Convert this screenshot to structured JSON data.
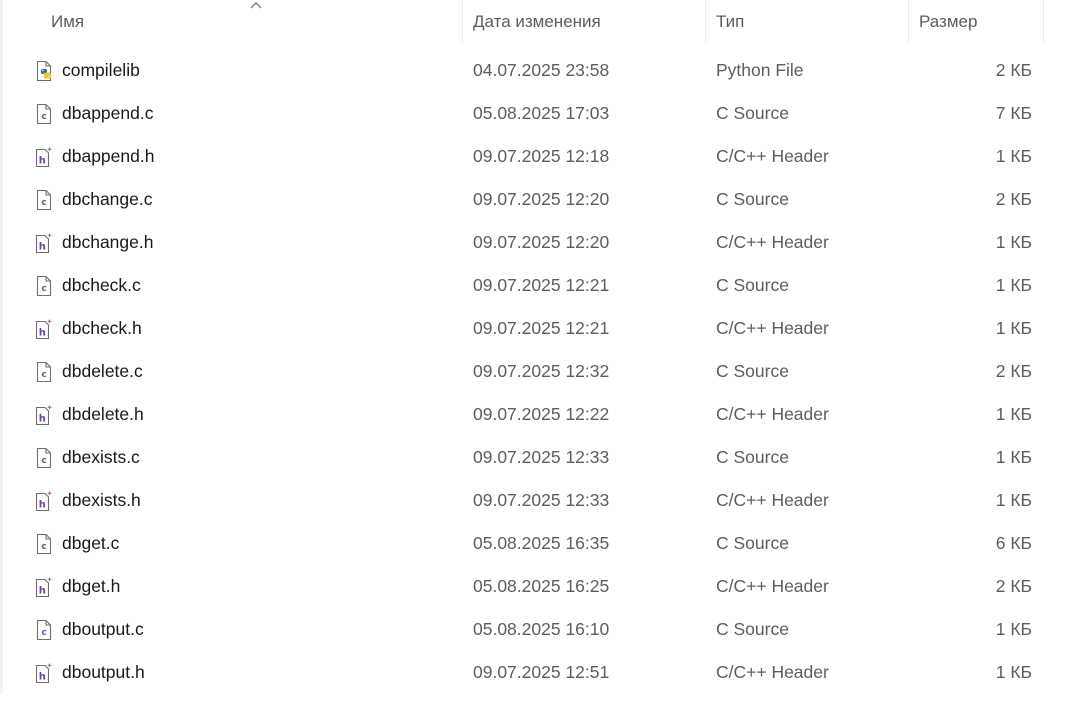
{
  "columns": {
    "name": "Имя",
    "date": "Дата изменения",
    "type": "Тип",
    "size": "Размер"
  },
  "sort": {
    "column": "name",
    "direction": "ascending"
  },
  "colors": {
    "c_source_icon": "#7a4f9a",
    "header_icon": "#6b3fa0",
    "header_icon_accent": "#c74fd0",
    "python_blue": "#3a6ea5",
    "python_yellow": "#f2c42c"
  },
  "files": [
    {
      "name": "compilelib",
      "date": "04.07.2025 23:58",
      "type": "Python File",
      "size": "2 КБ",
      "icon": "python-file-icon"
    },
    {
      "name": "dbappend.c",
      "date": "05.08.2025 17:03",
      "type": "C Source",
      "size": "7 КБ",
      "icon": "c-source-file-icon"
    },
    {
      "name": "dbappend.h",
      "date": "09.07.2025 12:18",
      "type": "C/C++ Header",
      "size": "1 КБ",
      "icon": "c-header-file-icon"
    },
    {
      "name": "dbchange.c",
      "date": "09.07.2025 12:20",
      "type": "C Source",
      "size": "2 КБ",
      "icon": "c-source-file-icon"
    },
    {
      "name": "dbchange.h",
      "date": "09.07.2025 12:20",
      "type": "C/C++ Header",
      "size": "1 КБ",
      "icon": "c-header-file-icon"
    },
    {
      "name": "dbcheck.c",
      "date": "09.07.2025 12:21",
      "type": "C Source",
      "size": "1 КБ",
      "icon": "c-source-file-icon"
    },
    {
      "name": "dbcheck.h",
      "date": "09.07.2025 12:21",
      "type": "C/C++ Header",
      "size": "1 КБ",
      "icon": "c-header-file-icon"
    },
    {
      "name": "dbdelete.c",
      "date": "09.07.2025 12:32",
      "type": "C Source",
      "size": "2 КБ",
      "icon": "c-source-file-icon"
    },
    {
      "name": "dbdelete.h",
      "date": "09.07.2025 12:22",
      "type": "C/C++ Header",
      "size": "1 КБ",
      "icon": "c-header-file-icon"
    },
    {
      "name": "dbexists.c",
      "date": "09.07.2025 12:33",
      "type": "C Source",
      "size": "1 КБ",
      "icon": "c-source-file-icon"
    },
    {
      "name": "dbexists.h",
      "date": "09.07.2025 12:33",
      "type": "C/C++ Header",
      "size": "1 КБ",
      "icon": "c-header-file-icon"
    },
    {
      "name": "dbget.c",
      "date": "05.08.2025 16:35",
      "type": "C Source",
      "size": "6 КБ",
      "icon": "c-source-file-icon"
    },
    {
      "name": "dbget.h",
      "date": "05.08.2025 16:25",
      "type": "C/C++ Header",
      "size": "2 КБ",
      "icon": "c-header-file-icon"
    },
    {
      "name": "dboutput.c",
      "date": "05.08.2025 16:10",
      "type": "C Source",
      "size": "1 КБ",
      "icon": "c-source-file-icon"
    },
    {
      "name": "dboutput.h",
      "date": "09.07.2025 12:51",
      "type": "C/C++ Header",
      "size": "1 КБ",
      "icon": "c-header-file-icon"
    }
  ]
}
